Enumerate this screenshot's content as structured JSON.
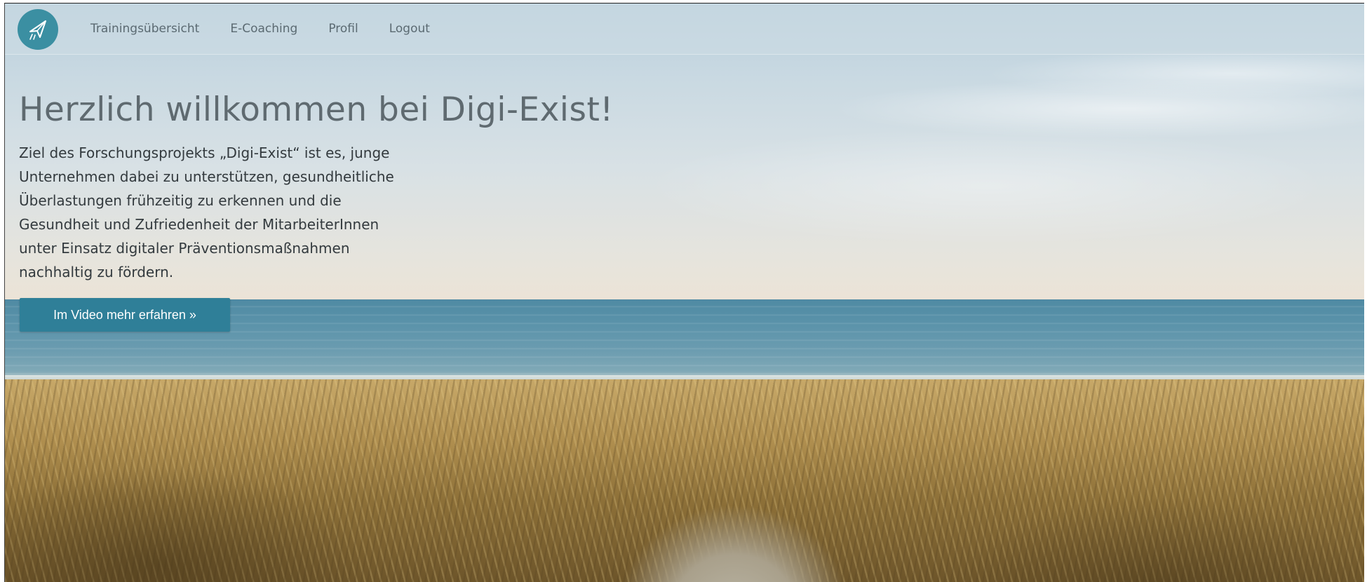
{
  "nav": {
    "logo_icon": "paper-plane-icon",
    "items": [
      {
        "label": "Trainingsübersicht"
      },
      {
        "label": "E-Coaching"
      },
      {
        "label": "Profil"
      },
      {
        "label": "Logout"
      }
    ]
  },
  "hero": {
    "title": "Herzlich willkommen bei Digi-Exist!",
    "lines": [
      "Ziel des Forschungsprojekts „Digi-Exist“ ist es, junge",
      "Unternehmen dabei zu unterstützen, gesundheitliche",
      "Überlastungen frühzeitig zu erkennen und die",
      "Gesundheit und Zufriedenheit der MitarbeiterInnen",
      "unter Einsatz digitaler Präventionsmaßnahmen",
      "nachhaltig zu fördern."
    ],
    "button_label": "Im Video mehr erfahren »"
  },
  "colors": {
    "accent": "#2f7f98",
    "logo_bg": "#3b8fa2",
    "nav_text": "#5b6a72",
    "title_text": "#5f6a70",
    "body_text": "#333a3e"
  }
}
